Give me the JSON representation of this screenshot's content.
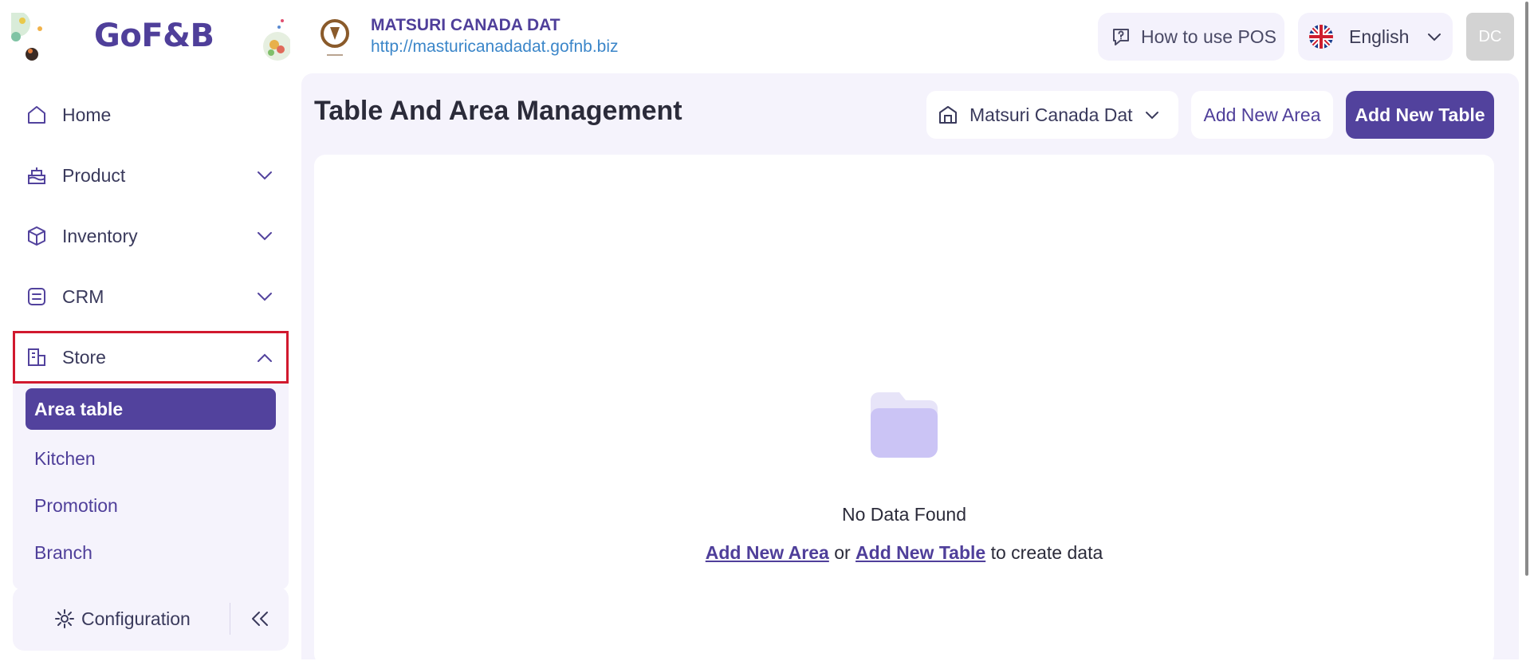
{
  "brand": {
    "logo": "GoF&B"
  },
  "store": {
    "name": "MATSURI CANADA DAT",
    "url": "http://masturicanadadat.gofnb.biz"
  },
  "header": {
    "how_to_label": "How to use POS",
    "language": "English",
    "avatar_initials": "DC"
  },
  "sidebar": {
    "items": [
      {
        "label": "Home",
        "icon": "home-icon"
      },
      {
        "label": "Product",
        "icon": "cake-icon"
      },
      {
        "label": "Inventory",
        "icon": "box-icon"
      },
      {
        "label": "CRM",
        "icon": "crm-icon"
      },
      {
        "label": "Store",
        "icon": "store-icon"
      }
    ],
    "store_sub": [
      {
        "label": "Area table"
      },
      {
        "label": "Kitchen"
      },
      {
        "label": "Promotion"
      },
      {
        "label": "Branch"
      }
    ],
    "config_label": "Configuration"
  },
  "main": {
    "title": "Table And Area Management",
    "branch": "Matsuri Canada Dat",
    "add_area_label": "Add New Area",
    "add_table_label": "Add New Table",
    "empty": {
      "title": "No Data Found",
      "link_area": "Add New Area",
      "or": "or",
      "link_table": "Add New Table",
      "suffix": "to create data"
    }
  },
  "colors": {
    "brand": "#52429d",
    "highlight": "#d1192e",
    "panel": "#f5f3fc",
    "link": "#3b86c9"
  }
}
